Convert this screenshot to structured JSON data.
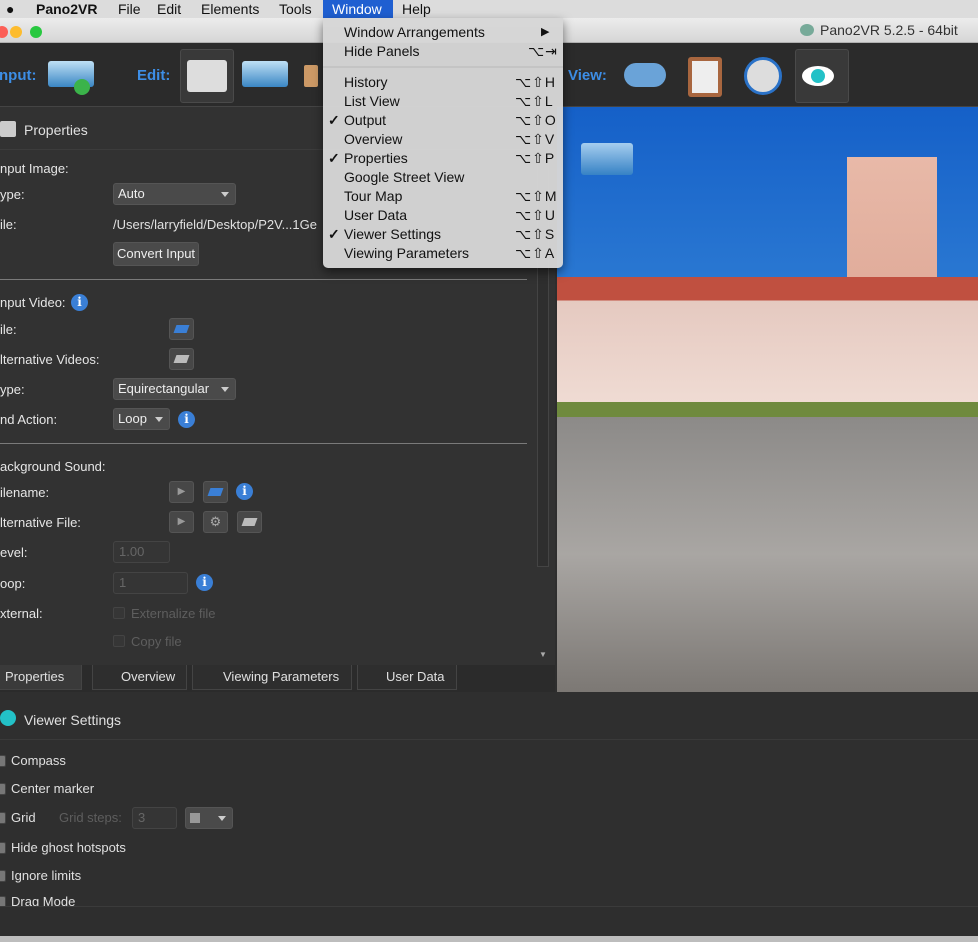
{
  "menubar": {
    "app": "Pano2VR",
    "items": [
      "File",
      "Edit",
      "Elements",
      "Tools",
      "Window",
      "Help"
    ],
    "active": "Window"
  },
  "window": {
    "title": "Pano2VR 5.2.5 - 64bit"
  },
  "toolbar": {
    "input_label": "nput:",
    "edit_label": "Edit:",
    "view_label": "View:"
  },
  "properties": {
    "title": "Properties",
    "input_image": {
      "heading": "nput Image:",
      "type_label": "ype:",
      "type_value": "Auto",
      "file_label": "ile:",
      "file_value": "/Users/larryfield/Desktop/P2V...1Ge",
      "convert_button": "Convert Input"
    },
    "input_video": {
      "heading": "nput Video:",
      "file_label": "ile:",
      "alt_label": "lternative Videos:",
      "type_label": "ype:",
      "type_value": "Equirectangular",
      "end_label": "nd Action:",
      "end_value": "Loop"
    },
    "background_sound": {
      "heading": "ackground Sound:",
      "filename_label": "ilename:",
      "alt_label": "lternative File:",
      "level_label": "evel:",
      "level_value": "1.00",
      "loop_label": "oop:",
      "loop_value": "1",
      "external_label": "xternal:",
      "externalize": "Externalize file",
      "copy": "Copy file"
    }
  },
  "tabs": [
    "Properties",
    "Overview",
    "Viewing Parameters",
    "User Data"
  ],
  "active_tab": "Properties",
  "viewer_settings": {
    "title": "Viewer Settings",
    "compass": "Compass",
    "center_marker": "Center marker",
    "grid": "Grid",
    "grid_steps_label": "Grid steps:",
    "grid_steps_value": "3",
    "hide_ghost": "Hide ghost hotspots",
    "ignore_limits": "Ignore limits",
    "drag_mode": "Drag Mode"
  },
  "window_menu": [
    {
      "label": "Window Arrangements",
      "shortcut": "▶",
      "checked": false
    },
    {
      "label": "Hide Panels",
      "shortcut": "⌥⇥",
      "checked": false
    },
    {
      "label": "History",
      "shortcut": "⌥⇧H",
      "checked": false
    },
    {
      "label": "List View",
      "shortcut": "⌥⇧L",
      "checked": false
    },
    {
      "label": "Output",
      "shortcut": "⌥⇧O",
      "checked": true
    },
    {
      "label": "Overview",
      "shortcut": "⌥⇧V",
      "checked": false
    },
    {
      "label": "Properties",
      "shortcut": "⌥⇧P",
      "checked": true
    },
    {
      "label": "Google Street View",
      "shortcut": "",
      "checked": false
    },
    {
      "label": "Tour Map",
      "shortcut": "⌥⇧M",
      "checked": false
    },
    {
      "label": "User Data",
      "shortcut": "⌥⇧U",
      "checked": false
    },
    {
      "label": "Viewer Settings",
      "shortcut": "⌥⇧S",
      "checked": true
    },
    {
      "label": "Viewing Parameters",
      "shortcut": "⌥⇧A",
      "checked": false
    }
  ],
  "check_mark": "✓",
  "colors": {
    "accent": "#3d8ee6",
    "menu_highlight": "#1f5fd1",
    "info": "#3a7fd6"
  }
}
